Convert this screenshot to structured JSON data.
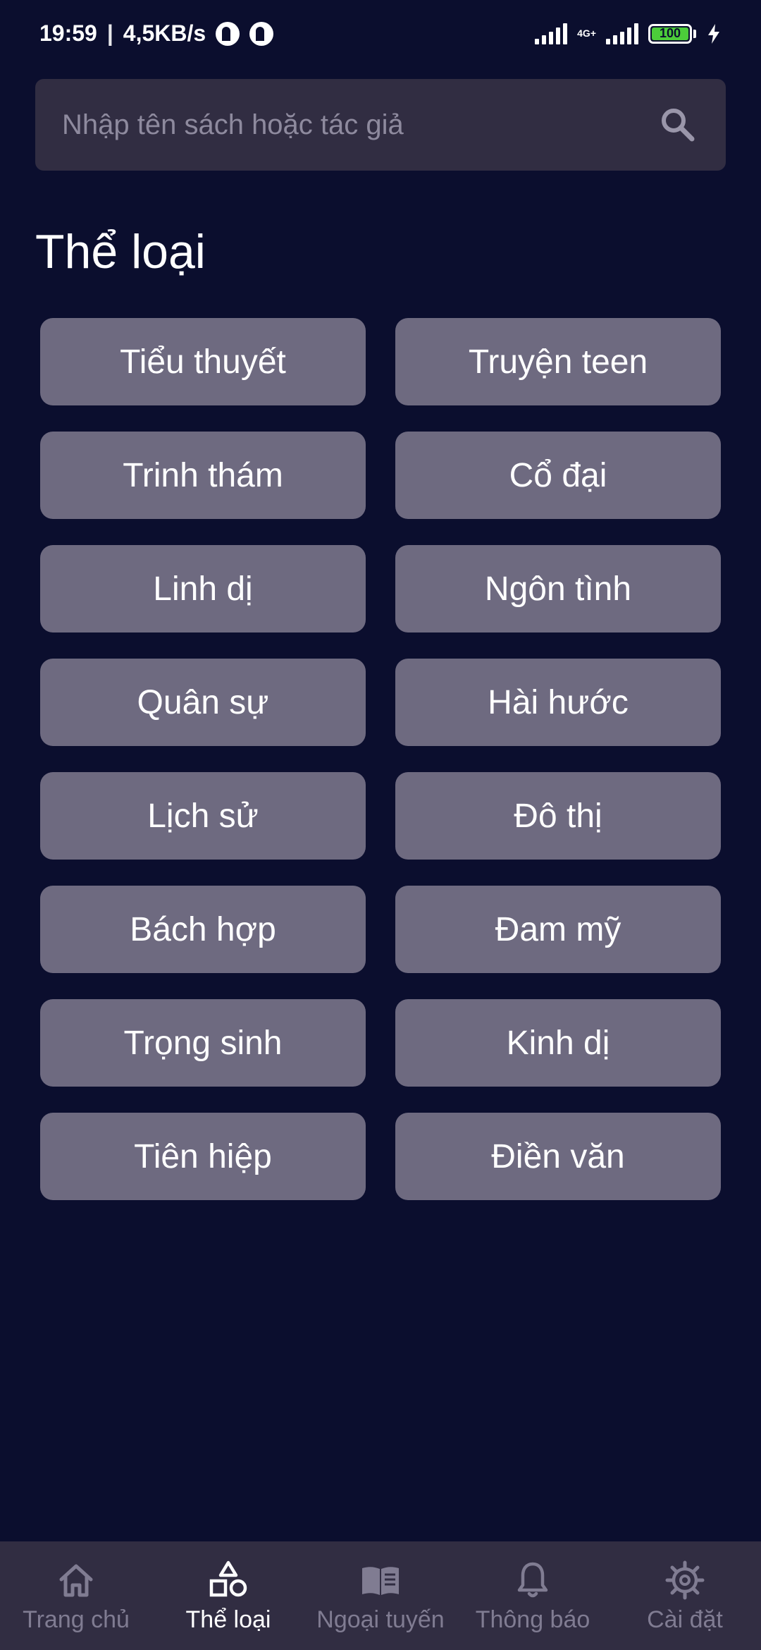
{
  "status_bar": {
    "time": "19:59",
    "separator": "|",
    "net_speed": "4,5KB/s",
    "network_type": "4G+",
    "battery": "100"
  },
  "search": {
    "placeholder": "Nhập tên sách hoặc tác giả",
    "icon": "search-icon"
  },
  "section_title": "Thể loại",
  "genres": [
    "Tiểu thuyết",
    "Truyện teen",
    "Trinh thám",
    "Cổ đại",
    "Linh dị",
    "Ngôn tình",
    "Quân sự",
    "Hài hước",
    "Lịch sử",
    "Đô thị",
    "Bách hợp",
    "Đam mỹ",
    "Trọng sinh",
    "Kinh dị",
    "Tiên hiệp",
    "Điền văn"
  ],
  "bottom_nav": {
    "items": [
      {
        "label": "Trang chủ",
        "icon": "home-icon"
      },
      {
        "label": "Thể loại",
        "icon": "category-shapes-icon"
      },
      {
        "label": "Ngoại tuyến",
        "icon": "book-open-icon"
      },
      {
        "label": "Thông báo",
        "icon": "bell-icon"
      },
      {
        "label": "Cài đặt",
        "icon": "gear-icon"
      }
    ],
    "active_index": 1
  },
  "colors": {
    "background": "#0b0e2e",
    "surface": "#312d42",
    "button": "#6e6a80",
    "inactive_nav": "#807c92",
    "battery": "#4ccd3a"
  }
}
